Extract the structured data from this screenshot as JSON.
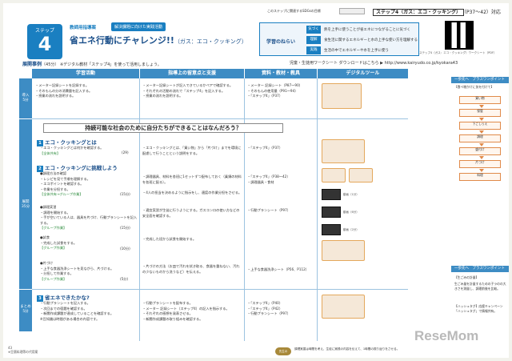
{
  "header": {
    "sdgs": "このステップに関連するSDGsの目標",
    "step_title_main": "ステップ4（ガス：エコ・クッキング）",
    "step_title_pages": "（P37〜42）対応"
  },
  "badge": {
    "step": "ステップ",
    "num": "4"
  },
  "guide": {
    "label": "教師用指導案",
    "tag": "解決課題に向けた実践活動"
  },
  "title": {
    "main": "省エネ行動にチャレンジ!!",
    "sub": "（ガス：エコ・クッキング）"
  },
  "aim": {
    "label": "学習のねらい",
    "rows": [
      {
        "tag": "気づく",
        "text": "熱を上手に使うことが省エネにつながることに気づく"
      },
      {
        "tag": "理解",
        "text": "食生活に関するエネルギーと水の上手な使い方を理解する"
      },
      {
        "tag": "実践",
        "text": "生活の中でエネルギーや水を上手に使う"
      }
    ]
  },
  "qr_caption": "ステップ4（ガス：エコ・クッキング）ワークシート（PDF）",
  "plan": {
    "label": "展開事例",
    "minutes": "（45分）",
    "note": "※デジタル教材「ステップ4」を使って活用しましょう。"
  },
  "worksheet": {
    "text": "児童・生徒用ワークシート ダウンロードはこちら ▶ http://www.kairyudo.co.jp/kyokara43"
  },
  "columns": [
    "学習活動",
    "指導上の留意点と支援",
    "資料・教材・教具",
    "デジタルツール"
  ],
  "rows": {
    "intro": "導入",
    "intro_min": "5分",
    "dev": "展開",
    "dev_min": "35分",
    "sum": "まとめ",
    "sum_min": "5分"
  },
  "intro": {
    "activity": [
      "・メーター記録シートを記録する。",
      "・そのもんの分の消費量を記入する。",
      "・授業の流れを説明する。"
    ],
    "support": [
      "・メーター記録シートが記入できているかペアで確認する。",
      "・それぞれの活動の流れで「ステップ4」を記入する。",
      "・授業の流れを説明する。"
    ],
    "material": [
      "・メーター 記録シート（P87〜90）",
      "・そのもんの使用量（P91〜94）",
      "・「ステップ4」（P37）"
    ]
  },
  "question": "持続可能な社会のために自分たちができることはなんだろう？",
  "sec1": {
    "num": "1",
    "head": "エコ・クッキングとは",
    "text": [
      "・エコ・クッキングとは何かを確認する。"
    ],
    "note": "【全体共有】",
    "pg": "(29)"
  },
  "sec2": {
    "num": "2",
    "head": "エコ・クッキングに挑戦しよう",
    "text": [
      "●調理方法の確認",
      "・レシピを見て手順を理解する。",
      "・エコポイントを確認する。",
      "・作業を分担する。"
    ],
    "note": "【全体共有→グループ作業】",
    "pg": "(15分)"
  },
  "sec2b": {
    "text": [
      "●調理実習",
      "・調理を開始する。",
      "・手が空いている人は、器具を片づけ、行動プランシートを記入する。"
    ],
    "note": "【グループ作業】",
    "pg": "(15分)"
  },
  "sec2c": {
    "text": [
      "●試食",
      "・完成した試食をする。"
    ],
    "note": "【グループ作業】",
    "pg": "(10分)"
  },
  "sec2d": {
    "text": [
      "●片づけ",
      "・上手な食器洗浄シートを見ながら、片づける。",
      "・分担して作業する。"
    ],
    "note": "【グループ作業】",
    "pg": "(5分)"
  },
  "support2": [
    "・エコ・クッキングとは、「買い物」から「片づけ」までを環境に配慮して行うことという説明をする。",
    "・調理器具、材料を各班に1セットずつ配布しておく（乗鍋の材料を各班に配る）。",
    "・4人の担当を決めるように指示をし、適度の作業分担をさせる。",
    "・適宜実習が生徒に行うようにする。ガスコンロの使い方などの安全面を確認する。",
    "・完成した班から試食を開始する。",
    "・片づけの方法（お皿で汚れを拭き取る、食器を重ねない、汚れの少ないものから洗うなど）を伝える。"
  ],
  "material2": [
    "・「ステップ4」（P37）",
    "・「ステップ4」（P38〜42）",
    "・調理器具・食材",
    "・行動プランシート（P97）",
    "・上手な食器洗浄シート（P56、P112）"
  ],
  "digital": {
    "url": "",
    "thumbs": [
      "動画（1分）",
      "動画（6分）",
      "動画（2分）"
    ]
  },
  "sec3": {
    "num": "3",
    "head": "省エネできたかな?",
    "text": [
      "・行動プランシートを記入する。",
      "・次回までの宿題を確認する。",
      "・新聞作成課題が達成していることを確認する。",
      "※豆知識は時間がある場合の内容です。"
    ]
  },
  "support3": [
    "・行動プランシートを配布する。",
    "・メーター 記録シート（ステップ4）の記入を指示する。",
    "・それぞれの感想を発表させる。",
    "・新聞作成課題の取り組みを確認する。"
  ],
  "material3": [
    "・「ステップ4」（P40）",
    "・「ステップ4」（P42）",
    "・行動プランシート（P97）"
  ],
  "sidebar": {
    "head1": "一歩先へ　プラスワンポイント",
    "intro": "【食べ物かけに気を付けて】",
    "flow": [
      "買い物",
      "保管",
      "下ごしらえ",
      "調理",
      "盛付け",
      "片づけ",
      "料理"
    ],
    "head2": "一歩先へ　プラスワンポイント",
    "tip_title": "【生ごみの計量】",
    "tip_text": "生ごみ量を計量するための子ラのの大きさを測量し、調理前後を比較。",
    "tip2": "【ハッシュタグ】応援キャンペーン「ハッシュタグ」で情報共有。"
  },
  "footer": {
    "page": "43",
    "note": "※豆腐料理等の代用案"
  },
  "prof": {
    "label": "先生の",
    "text": "調理実習は時間を考え、生徒に実践の内容を伝えて、1時間の振り返りをさせる。"
  },
  "logo": "ReseMom"
}
